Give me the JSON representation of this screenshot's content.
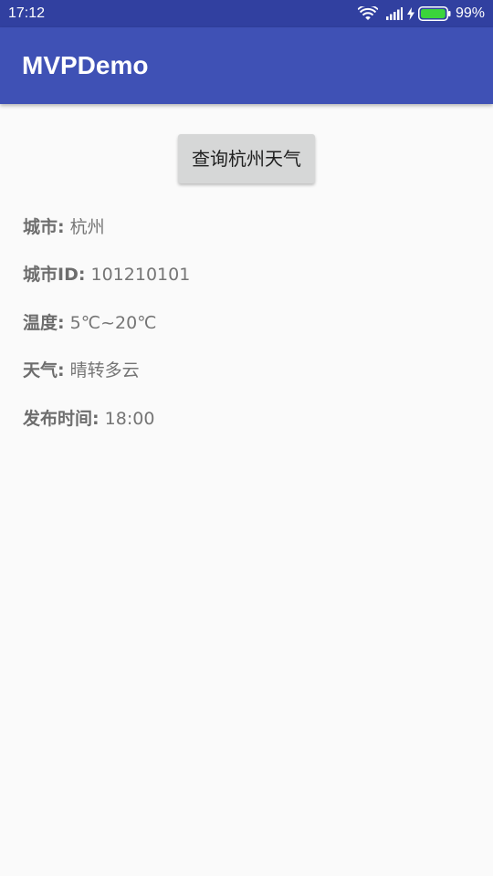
{
  "status_bar": {
    "time": "17:12",
    "battery_percent": "99%",
    "battery_level": 0.99,
    "icons": [
      "wifi-icon",
      "signal-icon",
      "charging-icon",
      "battery-icon"
    ]
  },
  "app_bar": {
    "title": "MVPDemo",
    "color": "#3f51b5"
  },
  "actions": {
    "query_button_label": "查询杭州天气"
  },
  "weather": [
    {
      "label": "城市:",
      "value": "杭州"
    },
    {
      "label": "城市ID:",
      "value": "101210101"
    },
    {
      "label": "温度:",
      "value": "5℃~20℃"
    },
    {
      "label": "天气:",
      "value": "晴转多云"
    },
    {
      "label": "发布时间:",
      "value": "18:00"
    }
  ]
}
